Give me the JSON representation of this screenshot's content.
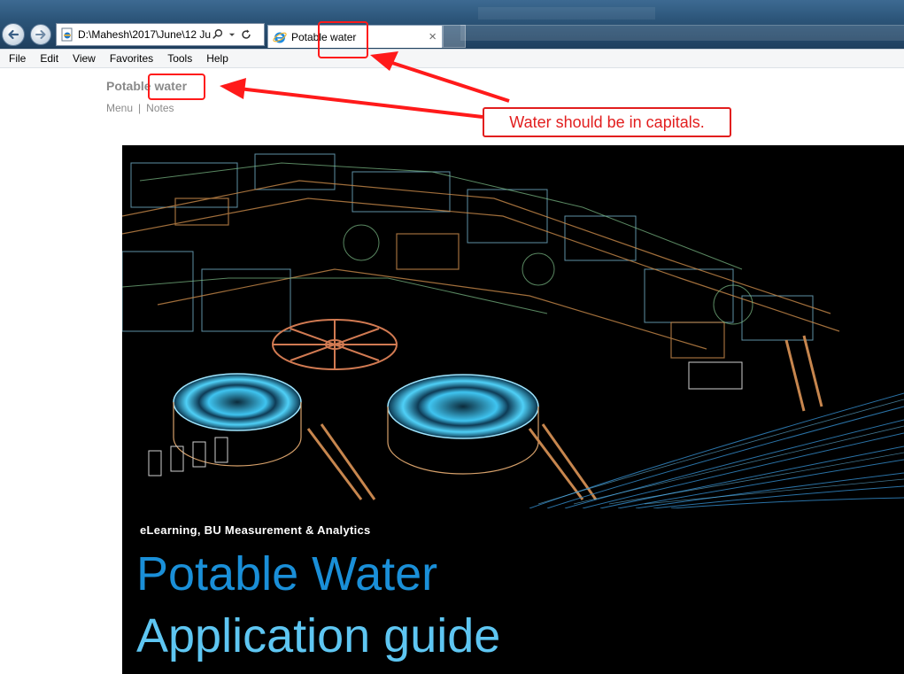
{
  "browser": {
    "address": "D:\\Mahesh\\2017\\June\\12 Jur",
    "tab_title": "Potable water",
    "tab_close": "×"
  },
  "menu": [
    "File",
    "Edit",
    "View",
    "Favorites",
    "Tools",
    "Help"
  ],
  "page": {
    "title": "Potable water",
    "links": [
      "Menu",
      "Notes"
    ],
    "link_separator": "|"
  },
  "hero": {
    "subheading": "eLearning, BU Measurement  & Analytics",
    "title": "Potable Water",
    "subtitle": "Application guide"
  },
  "annotation": {
    "text": "Water should be in capitals."
  },
  "colors": {
    "accent_title": "#1a8fd8",
    "accent_subtitle": "#5ec6f2",
    "annotation": "#e21e1e"
  }
}
